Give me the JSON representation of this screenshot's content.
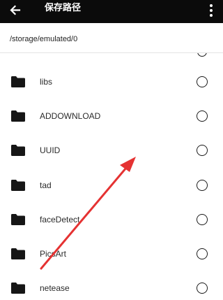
{
  "appbar": {
    "title": "保存路径",
    "back_icon": "arrow-left-icon",
    "more_icon": "more-vertical-icon",
    "background": "#0b0b0b"
  },
  "path": {
    "current": "/storage/emulated/0"
  },
  "folders": [
    {
      "label": "libs",
      "icon": "folder-icon",
      "selected": false
    },
    {
      "label": "ADDOWNLOAD",
      "icon": "folder-icon",
      "selected": false
    },
    {
      "label": "UUID",
      "icon": "folder-icon",
      "selected": false
    },
    {
      "label": "tad",
      "icon": "folder-icon",
      "selected": false
    },
    {
      "label": "faceDetect",
      "icon": "folder-icon",
      "selected": false
    },
    {
      "label": "PicsArt",
      "icon": "folder-icon",
      "selected": false
    },
    {
      "label": "netease",
      "icon": "folder-icon",
      "selected": false
    }
  ],
  "annotation": {
    "type": "arrow",
    "color": "#e53232"
  }
}
